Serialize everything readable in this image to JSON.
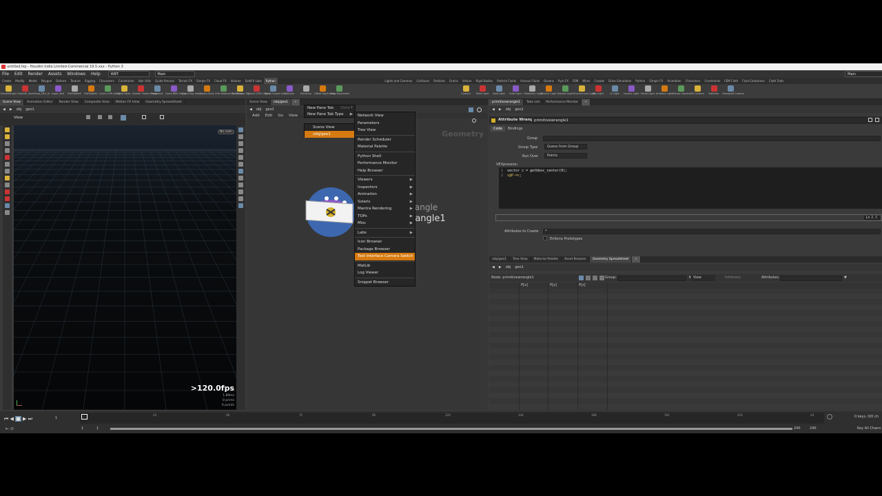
{
  "app": {
    "title": "untitled.hip - Houdini Indie Limited-Commercial 19.5.xxx - Python 3"
  },
  "menubar": {
    "items": [
      "File",
      "Edit",
      "Render",
      "Assets",
      "Windows",
      "Help"
    ],
    "desktop": "WBT",
    "main": "Main",
    "main_right": "Main"
  },
  "shelf_tabs_left": [
    "Create",
    "Modify",
    "Model",
    "Polygon",
    "Deform",
    "Texture",
    "Rigging",
    "Characters",
    "Constraints",
    "Hair Utils",
    "Guide Process",
    "Terrain FX",
    "Simple FX",
    "Cloud FX",
    "Volume",
    "SideFX Labs",
    "Python"
  ],
  "shelf_tabs_right": [
    "Lights and Cameras",
    "Collisions",
    "Particles",
    "Grains",
    "Vellum",
    "Rigid Bodies",
    "Particle Fluids",
    "Viscous Fluids",
    "Oceans",
    "Pyro FX",
    "FEM",
    "Wires",
    "Crowds",
    "Drive Simulation",
    "Python",
    "Simple FX",
    "Animation",
    "Characters",
    "Constraints",
    "FEM Cloth",
    "Fluid Containers",
    "Cloth Tools"
  ],
  "shelf_tools_left": [
    "SceneMerger",
    "CreateIP_Geo",
    "Setup_FBX_Id",
    "Super_Null",
    "FileToWebX",
    "FileToWebV",
    "Quick LOPs Setup",
    "Build Node",
    "Scatter Object Merge",
    "Comment",
    "Quick BBO Setup",
    "Quick Pop Setup",
    "Create Nulls",
    "Grid Material Per Mesh",
    "Quick Loop Top",
    "Quick COPs Check",
    "Spore Import Geo",
    "Collision",
    "Extractor",
    "Offset Keyframes",
    "Flag Keyframes"
  ],
  "shelf_tools_right": [
    "Camera",
    "Point Light",
    "Spot Light",
    "Area Light",
    "Geometry Light",
    "Volume Light",
    "Distant Light",
    "Environment Light",
    "Sky Light",
    "GI Light",
    "Caustic Light",
    "Portal Light",
    "Ambient Light",
    "Stereo Camera",
    "VR Camera",
    "Switcher",
    "Gamepad Camera"
  ],
  "left_pane": {
    "tabs": [
      "Scene View",
      "Animation Editor",
      "Render View",
      "Composite View",
      "Motion FX View",
      "Geometry Spreadsheet"
    ],
    "path": [
      "obj",
      "geo1"
    ],
    "view_label": "View",
    "persp": "Persp",
    "cam": "No cam",
    "fps": ">120.0fps",
    "fps_sub1": "1.89ms",
    "fps_sub2": "0 prims",
    "fps_sub3": "0 points"
  },
  "mid_pane": {
    "tab": "/obj/geo1",
    "path": [
      "obj",
      "geo1"
    ],
    "menu": [
      "Add",
      "Edit",
      "Go",
      "View"
    ],
    "geometry_label": "Geometry",
    "node_label_top": "rangle",
    "node_label": "rangle1"
  },
  "new_tab_menu": {
    "items": [
      "New Pane Tab",
      "New Pane Tab Type"
    ],
    "shortcut": "Ctrl+T",
    "sub": [
      "Scene View",
      "/obj/geo1"
    ]
  },
  "pane_type_menu": {
    "groups": [
      [
        "Network View",
        "Parameters",
        "Tree View"
      ],
      [
        "Render Scheduler",
        "Material Palette"
      ],
      [
        "Python Shell",
        "Performance Monitor",
        "Help Browser"
      ],
      [
        "Viewers",
        "Inspectors",
        "Animation",
        "Solaris",
        "Mantra Rendering",
        "TOPs",
        "Misc"
      ],
      [
        "Labs"
      ],
      [
        "Icon Browser",
        "Package Browser",
        "Test Interface Camera Switch"
      ],
      [
        "MatLib",
        "Log Viewer"
      ],
      [
        "Snippet Browser"
      ]
    ],
    "submenu_items": [
      "Viewers",
      "Inspectors",
      "Animation",
      "Solaris",
      "Mantra Rendering",
      "TOPs",
      "Misc",
      "Labs"
    ],
    "highlighted": "Test Interface Camera Switch"
  },
  "right_pane": {
    "tabs": [
      "primitivewrangle1",
      "Take List",
      "Performance Monitor"
    ],
    "path": [
      "obj",
      "geo1"
    ],
    "node_type": "Attribute Wrangle",
    "node_name": "primitivewrangle1",
    "subtabs": [
      "Code",
      "Bindings"
    ],
    "group_label": "Group",
    "group_type_label": "Group Type",
    "group_type_value": "Guess from Group",
    "run_over_label": "Run Over",
    "run_over_value": "Points",
    "vex_label": "VEXpression",
    "code": [
      "vector c = getbbox_center(0);",
      "v@P-=c;"
    ],
    "line_nums": [
      "1",
      "2"
    ],
    "line_col": "Ln 2, C",
    "attrs_label": "Attributes to Create",
    "attrs_value": "*",
    "enforce": "Enforce Prototypes"
  },
  "sheet_pane": {
    "tabs": [
      "/obj/geo1",
      "Tree View",
      "Material Palette",
      "Asset Browser",
      "Geometry Spreadsheet"
    ],
    "path": [
      "obj",
      "geo1"
    ],
    "node": "Node: primitivewrangle1",
    "group": "Group:",
    "view": "View",
    "intrinsics": "Intrinsics",
    "attributes": "Attributes:",
    "cols": [
      "P[x]",
      "P[y]",
      "P[z]"
    ]
  },
  "timeline": {
    "ticks": [
      "24",
      "48",
      "72",
      "96",
      "120",
      "144",
      "168",
      "192",
      "216",
      "24"
    ],
    "frame": "1",
    "start": "1",
    "start2": "1",
    "end": "240",
    "end2": "240",
    "keys": "0 keys, 0/0 ch",
    "keyall": "Key All Chann"
  }
}
